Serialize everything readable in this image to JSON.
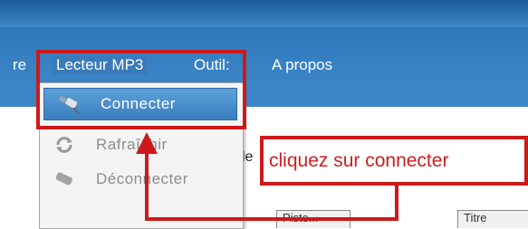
{
  "menubar": {
    "partial_label": "re",
    "lecteur_mp3": "Lecteur MP3",
    "outil": "Outil:",
    "apropos": "A propos"
  },
  "dropdown": {
    "items": [
      {
        "label": "Connecter",
        "icon": "usb-plug-icon",
        "state": "highlighted"
      },
      {
        "label": "Rafraîchir",
        "icon": "refresh-icon",
        "state": "disabled"
      },
      {
        "label": "Déconnecter",
        "icon": "unplug-icon",
        "state": "disabled"
      }
    ]
  },
  "background": {
    "partial_label": "le",
    "columns": [
      "Piste...",
      "Titre"
    ]
  },
  "annotation": {
    "callout_text": "cliquez sur connecter",
    "color": "#cc1a1a"
  }
}
